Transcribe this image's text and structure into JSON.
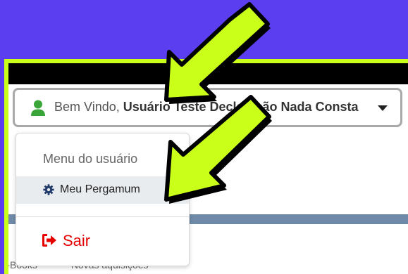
{
  "user_bar": {
    "welcome": "Bem Vindo,",
    "user_name": "Usuário Teste Declaração Nada Consta"
  },
  "dropdown": {
    "header": "Menu do usuário",
    "items": [
      {
        "label": "Meu Pergamum",
        "icon": "gear-icon"
      }
    ],
    "logout": {
      "label": "Sair",
      "icon": "sign-out-icon"
    }
  },
  "background_tabs": {
    "items": [
      "E-Books",
      "Novas aquisições"
    ]
  },
  "colors": {
    "background": "#5b3ef0",
    "frame": "#caff1a",
    "arrow_fill": "#caff1a",
    "arrow_stroke": "#000000",
    "user_icon": "#3aa63a",
    "logout": "#e60000"
  }
}
